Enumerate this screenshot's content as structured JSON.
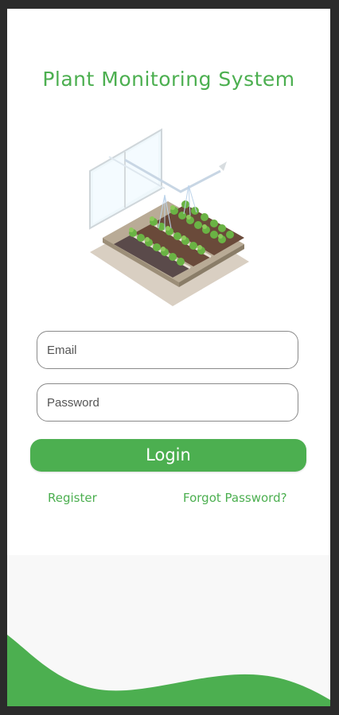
{
  "app": {
    "title": "Plant Monitoring System"
  },
  "illustration": {
    "icon": "greenhouse-irrigation-illustration"
  },
  "form": {
    "email_placeholder": "Email",
    "email_value": "",
    "password_placeholder": "Password",
    "password_value": "",
    "login_label": "Login"
  },
  "links": {
    "register_label": "Register",
    "forgot_label": "Forgot Password?"
  },
  "colors": {
    "accent": "#4caf50",
    "background": "#ffffff",
    "footer": "#f8f8f8",
    "frame": "#2b2b2b"
  }
}
